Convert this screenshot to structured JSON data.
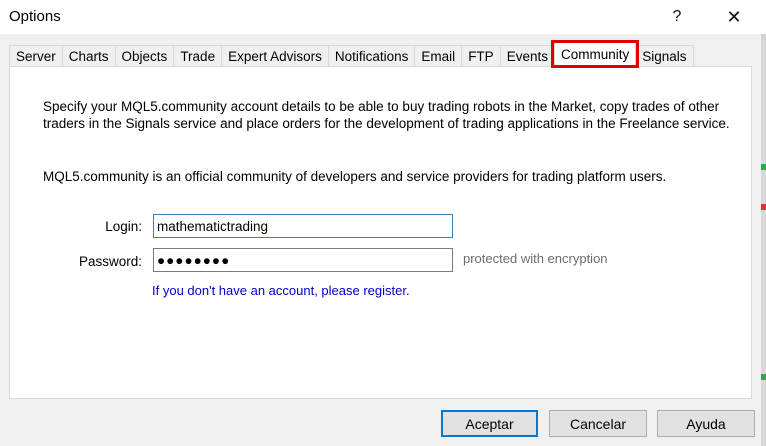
{
  "window": {
    "title": "Options",
    "help_glyph": "?",
    "close_glyph": "✕"
  },
  "tabs": [
    {
      "label": "Server"
    },
    {
      "label": "Charts"
    },
    {
      "label": "Objects"
    },
    {
      "label": "Trade"
    },
    {
      "label": "Expert Advisors"
    },
    {
      "label": "Notifications"
    },
    {
      "label": "Email"
    },
    {
      "label": "FTP"
    },
    {
      "label": "Events"
    },
    {
      "label": "Community",
      "active": true
    },
    {
      "label": "Signals"
    }
  ],
  "community": {
    "intro": "Specify your MQL5.community account details to be able to buy trading robots in the Market, copy trades of other traders in the Signals service and place orders for the development of trading applications in the Freelance service.",
    "about": "MQL5.community is an official community of developers and service providers for trading platform users.",
    "login_label": "Login:",
    "login_value": "mathematictrading",
    "password_label": "Password:",
    "password_value": "●●●●●●●●",
    "encryption_hint": "protected with encryption",
    "register_link": "If you don't have an account, please register."
  },
  "buttons": {
    "ok": "Aceptar",
    "cancel": "Cancelar",
    "help": "Ayuda"
  },
  "colors": {
    "highlight": "#e00000",
    "link": "#0000cc",
    "default_button_border": "#0078d7"
  }
}
